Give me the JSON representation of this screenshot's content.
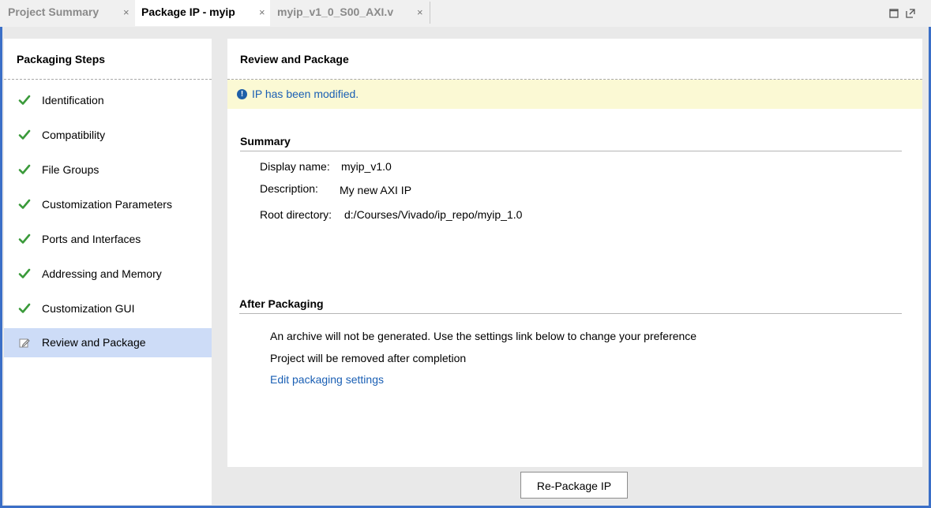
{
  "tabs": [
    {
      "label": "Project Summary",
      "close": "×",
      "active": false
    },
    {
      "label": "Package IP - myip",
      "close": "×",
      "active": true
    },
    {
      "label": "myip_v1_0_S00_AXI.v",
      "close": "×",
      "active": false
    }
  ],
  "window_icons": [
    "maximize-icon",
    "float-icon"
  ],
  "left_panel": {
    "title": "Packaging Steps",
    "steps": [
      {
        "label": "Identification",
        "icon": "check-icon",
        "selected": false
      },
      {
        "label": "Compatibility",
        "icon": "check-icon",
        "selected": false
      },
      {
        "label": "File Groups",
        "icon": "check-icon",
        "selected": false
      },
      {
        "label": "Customization Parameters",
        "icon": "check-icon",
        "selected": false
      },
      {
        "label": "Ports and Interfaces",
        "icon": "check-icon",
        "selected": false
      },
      {
        "label": "Addressing and Memory",
        "icon": "check-icon",
        "selected": false
      },
      {
        "label": "Customization GUI",
        "icon": "check-icon",
        "selected": false
      },
      {
        "label": "Review and Package",
        "icon": "edit-icon",
        "selected": true
      }
    ]
  },
  "main": {
    "title": "Review and Package",
    "banner": {
      "icon": "info-icon",
      "text": "IP has been modified."
    },
    "summary": {
      "title": "Summary",
      "display_name_label": "Display name:",
      "display_name": "myip_v1.0",
      "description_label": "Description:",
      "description": "My new AXI IP",
      "root_dir_label": "Root directory:",
      "root_dir": "d:/Courses/Vivado/ip_repo/myip_1.0"
    },
    "after_packaging": {
      "title": "After Packaging",
      "line1": "An archive will not be generated. Use the settings link below to change your preference",
      "line2": "Project will be removed after completion",
      "link": "Edit packaging settings"
    },
    "repackage_button": "Re-Package IP"
  },
  "colors": {
    "frame_blue": "#3b6fc7",
    "check_green": "#3a9a3a",
    "selected_bg": "#cddcf7",
    "banner_bg": "#fbf9d4",
    "link_blue": "#1a5fb4"
  }
}
